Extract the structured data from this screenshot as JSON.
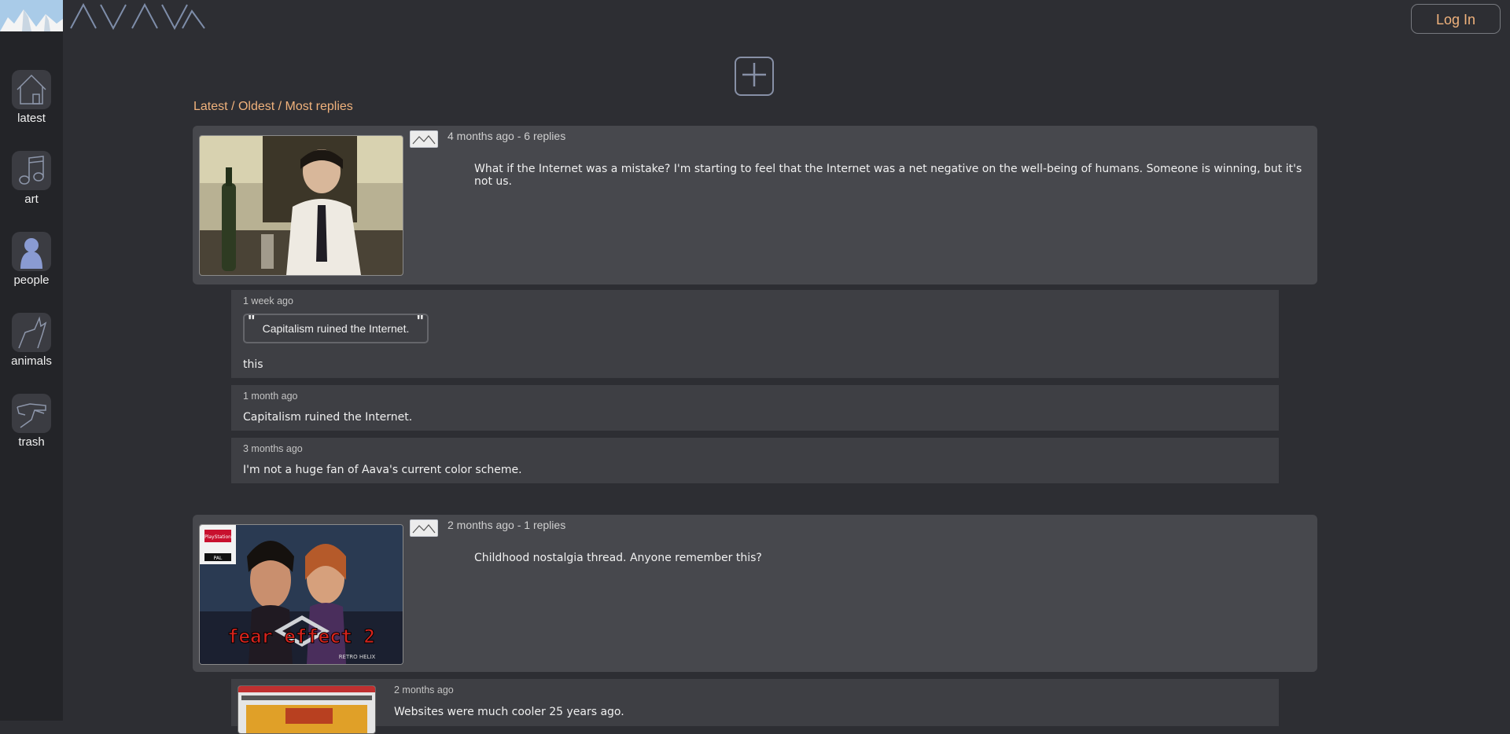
{
  "header": {
    "login_label": "Log In"
  },
  "sidebar": {
    "items": [
      {
        "label": "latest",
        "icon": "home-icon"
      },
      {
        "label": "art",
        "icon": "music-note-icon"
      },
      {
        "label": "people",
        "icon": "person-icon"
      },
      {
        "label": "animals",
        "icon": "cat-icon"
      },
      {
        "label": "trash",
        "icon": "hand-icon"
      }
    ]
  },
  "sort": {
    "latest": "Latest",
    "oldest": "Oldest",
    "most_replies": "Most replies",
    "sep": " / "
  },
  "threads": [
    {
      "meta": "4 months ago - 6 replies",
      "text": "What if the Internet was a mistake? I'm starting to feel that the Internet was a net negative on the well-being of humans. Someone is winning, but it's not us.",
      "replies": [
        {
          "meta": "1 week ago",
          "quote": "Capitalism ruined the Internet.",
          "text": "this"
        },
        {
          "meta": "1 month ago",
          "text": "Capitalism ruined the Internet."
        },
        {
          "meta": "3 months ago",
          "text": "I'm not a huge fan of Aava's current color scheme."
        }
      ]
    },
    {
      "meta": "2 months ago - 1 replies",
      "text": "Childhood nostalgia thread. Anyone remember this?",
      "image_caption": "fear effect 2",
      "image_sub": "RETRO HELIX",
      "image_badge": "PlayStation",
      "image_region": "PAL",
      "replies": [
        {
          "meta": "2 months ago",
          "text": "Websites were much cooler 25 years ago."
        }
      ]
    }
  ],
  "colors": {
    "background": "#2d2e33",
    "sidebar": "#232428",
    "card": "#47484d",
    "reply": "#3e3f44",
    "accent": "#f0b27c"
  }
}
